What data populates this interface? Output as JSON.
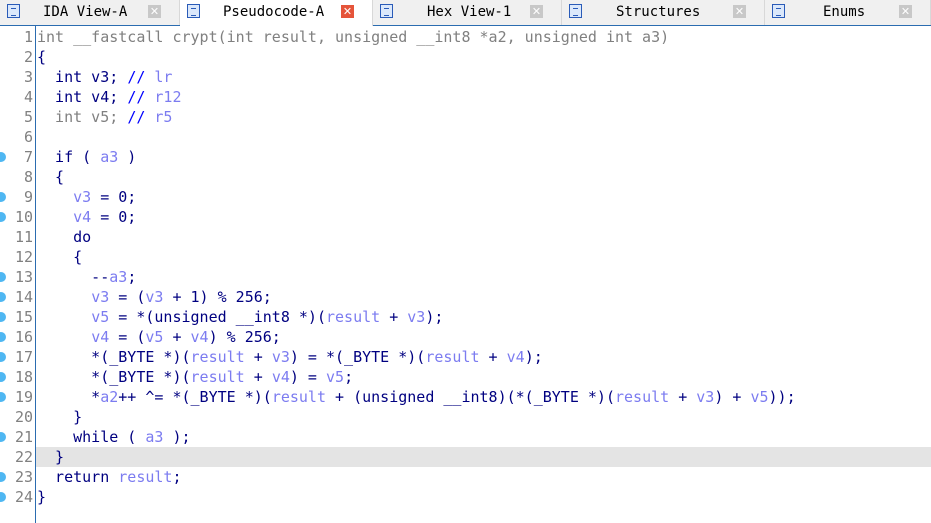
{
  "tabs": [
    {
      "label": "IDA View-A",
      "icon": "disassembly-icon",
      "active": false
    },
    {
      "label": "Pseudocode-A",
      "icon": "pseudocode-icon",
      "active": true
    },
    {
      "label": "Hex View-1",
      "icon": "hex-icon",
      "active": false
    },
    {
      "label": "Structures",
      "icon": "structures-icon",
      "active": false
    },
    {
      "label": "Enums",
      "icon": "enums-icon",
      "active": false
    }
  ],
  "colors": {
    "keyword": "#000080",
    "variable": "#7c7cf0",
    "gray": "#808080",
    "comment": "#0000ff",
    "breakpoint_dot": "#4fb7f2",
    "current_line": "#e4e4e4"
  },
  "highlighted_line": 22,
  "lines": [
    {
      "n": "1",
      "dot": false,
      "t": [
        [
          "g",
          "int __fastcall crypt(int result, unsigned __int8 *a2, unsigned int a3)"
        ]
      ]
    },
    {
      "n": "2",
      "dot": false,
      "t": [
        [
          "k",
          "{"
        ]
      ]
    },
    {
      "n": "3",
      "dot": false,
      "t": [
        [
          "k",
          "  int v3; "
        ],
        [
          "c",
          "// "
        ],
        [
          "v",
          "lr"
        ]
      ]
    },
    {
      "n": "4",
      "dot": false,
      "t": [
        [
          "k",
          "  int v4; "
        ],
        [
          "c",
          "// "
        ],
        [
          "v",
          "r12"
        ]
      ]
    },
    {
      "n": "5",
      "dot": false,
      "t": [
        [
          "g",
          "  int v5; "
        ],
        [
          "c",
          "// "
        ],
        [
          "v",
          "r5"
        ]
      ]
    },
    {
      "n": "6",
      "dot": false,
      "t": []
    },
    {
      "n": "7",
      "dot": true,
      "t": [
        [
          "k",
          "  if ( "
        ],
        [
          "v",
          "a3"
        ],
        [
          "k",
          " )"
        ]
      ]
    },
    {
      "n": "8",
      "dot": false,
      "t": [
        [
          "k",
          "  {"
        ]
      ]
    },
    {
      "n": "9",
      "dot": true,
      "t": [
        [
          "k",
          "    "
        ],
        [
          "v",
          "v3"
        ],
        [
          "k",
          " = 0;"
        ]
      ]
    },
    {
      "n": "10",
      "dot": true,
      "t": [
        [
          "k",
          "    "
        ],
        [
          "v",
          "v4"
        ],
        [
          "k",
          " = 0;"
        ]
      ]
    },
    {
      "n": "11",
      "dot": false,
      "t": [
        [
          "k",
          "    do"
        ]
      ]
    },
    {
      "n": "12",
      "dot": false,
      "t": [
        [
          "k",
          "    {"
        ]
      ]
    },
    {
      "n": "13",
      "dot": true,
      "t": [
        [
          "k",
          "      --"
        ],
        [
          "v",
          "a3"
        ],
        [
          "k",
          ";"
        ]
      ]
    },
    {
      "n": "14",
      "dot": true,
      "t": [
        [
          "k",
          "      "
        ],
        [
          "v",
          "v3"
        ],
        [
          "k",
          " = ("
        ],
        [
          "v",
          "v3"
        ],
        [
          "k",
          " + 1) % 256;"
        ]
      ]
    },
    {
      "n": "15",
      "dot": true,
      "t": [
        [
          "k",
          "      "
        ],
        [
          "v",
          "v5"
        ],
        [
          "k",
          " = *(unsigned __int8 *)("
        ],
        [
          "v",
          "result"
        ],
        [
          "k",
          " + "
        ],
        [
          "v",
          "v3"
        ],
        [
          "k",
          ");"
        ]
      ]
    },
    {
      "n": "16",
      "dot": true,
      "t": [
        [
          "k",
          "      "
        ],
        [
          "v",
          "v4"
        ],
        [
          "k",
          " = ("
        ],
        [
          "v",
          "v5"
        ],
        [
          "k",
          " + "
        ],
        [
          "v",
          "v4"
        ],
        [
          "k",
          ") % 256;"
        ]
      ]
    },
    {
      "n": "17",
      "dot": true,
      "t": [
        [
          "k",
          "      *(_BYTE *)("
        ],
        [
          "v",
          "result"
        ],
        [
          "k",
          " + "
        ],
        [
          "v",
          "v3"
        ],
        [
          "k",
          ") = *(_BYTE *)("
        ],
        [
          "v",
          "result"
        ],
        [
          "k",
          " + "
        ],
        [
          "v",
          "v4"
        ],
        [
          "k",
          ");"
        ]
      ]
    },
    {
      "n": "18",
      "dot": true,
      "t": [
        [
          "k",
          "      *(_BYTE *)("
        ],
        [
          "v",
          "result"
        ],
        [
          "k",
          " + "
        ],
        [
          "v",
          "v4"
        ],
        [
          "k",
          ") = "
        ],
        [
          "v",
          "v5"
        ],
        [
          "k",
          ";"
        ]
      ]
    },
    {
      "n": "19",
      "dot": true,
      "t": [
        [
          "k",
          "      *"
        ],
        [
          "v",
          "a2"
        ],
        [
          "k",
          "++ ^= *(_BYTE *)("
        ],
        [
          "v",
          "result"
        ],
        [
          "k",
          " + (unsigned __int8)(*(_BYTE *)("
        ],
        [
          "v",
          "result"
        ],
        [
          "k",
          " + "
        ],
        [
          "v",
          "v3"
        ],
        [
          "k",
          ") + "
        ],
        [
          "v",
          "v5"
        ],
        [
          "k",
          "));"
        ]
      ]
    },
    {
      "n": "20",
      "dot": false,
      "t": [
        [
          "k",
          "    }"
        ]
      ]
    },
    {
      "n": "21",
      "dot": true,
      "t": [
        [
          "k",
          "    while ( "
        ],
        [
          "v",
          "a3"
        ],
        [
          "k",
          " );"
        ]
      ]
    },
    {
      "n": "22",
      "dot": false,
      "t": [
        [
          "k",
          "  }"
        ]
      ]
    },
    {
      "n": "23",
      "dot": true,
      "t": [
        [
          "k",
          "  return "
        ],
        [
          "v",
          "result"
        ],
        [
          "k",
          ";"
        ]
      ]
    },
    {
      "n": "24",
      "dot": true,
      "t": [
        [
          "k",
          "}"
        ]
      ]
    }
  ]
}
